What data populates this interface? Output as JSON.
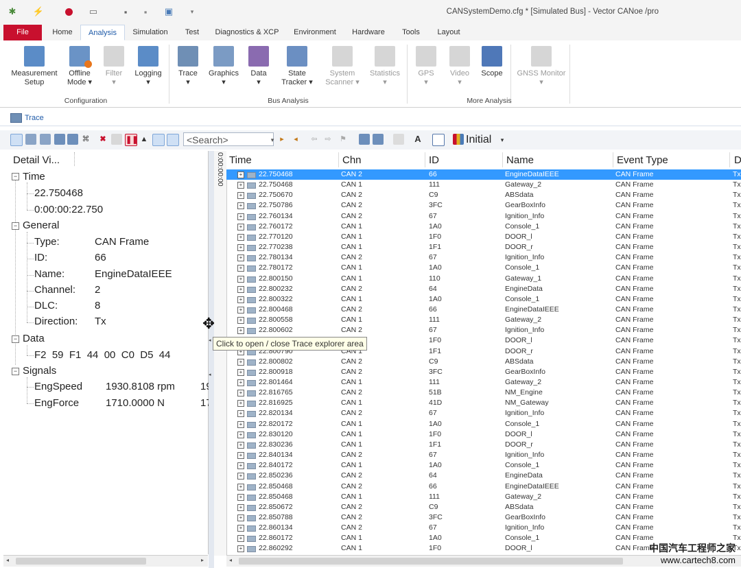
{
  "window": {
    "title": "CANSystemDemo.cfg * [Simulated Bus] - Vector CANoe /pro"
  },
  "tabs": [
    "File",
    "Home",
    "Analysis",
    "Simulation",
    "Test",
    "Diagnostics & XCP",
    "Environment",
    "Hardware",
    "Tools",
    "Layout"
  ],
  "active_tab": "Analysis",
  "ribbon": {
    "configuration": {
      "group": "Configuration",
      "buttons": [
        {
          "l1": "Measurement",
          "l2": "Setup",
          "icon": "measurement-setup-icon"
        },
        {
          "l1": "Offline",
          "l2": "Mode ▾",
          "icon": "offline-mode-icon"
        },
        {
          "l1": "Filter",
          "l2": "▾",
          "icon": "filter-icon"
        },
        {
          "l1": "Logging",
          "l2": "▾",
          "icon": "logging-icon"
        }
      ]
    },
    "bus_analysis": {
      "group": "Bus Analysis",
      "buttons": [
        {
          "l1": "Trace",
          "l2": "▾",
          "icon": "trace-icon"
        },
        {
          "l1": "Graphics",
          "l2": "▾",
          "icon": "graphics-icon"
        },
        {
          "l1": "Data",
          "l2": "▾",
          "icon": "data-icon"
        },
        {
          "l1": "State",
          "l2": "Tracker ▾",
          "icon": "state-tracker-icon"
        },
        {
          "l1": "System",
          "l2": "Scanner ▾",
          "icon": "system-scanner-icon"
        },
        {
          "l1": "Statistics",
          "l2": "▾",
          "icon": "statistics-icon"
        }
      ]
    },
    "more_analysis": {
      "group": "More Analysis",
      "buttons": [
        {
          "l1": "GPS",
          "l2": "▾",
          "icon": "gps-icon"
        },
        {
          "l1": "Video",
          "l2": "▾",
          "icon": "video-icon"
        },
        {
          "l1": "Scope",
          "l2": "",
          "icon": "scope-icon"
        },
        {
          "l1": "GNSS Monitor",
          "l2": "▾",
          "icon": "gnss-monitor-icon"
        }
      ]
    }
  },
  "trace_window": {
    "title": "Trace",
    "search_placeholder": "<Search>",
    "layout_label": "Initial",
    "time_axis_label": "0:00:00:00"
  },
  "detail_view": {
    "header": "Detail Vi...",
    "time": {
      "label": "Time",
      "seconds": "22.750468",
      "formatted": "0:00:00:22.750"
    },
    "general": {
      "label": "General",
      "fields": [
        {
          "k": "Type:",
          "v": "CAN Frame"
        },
        {
          "k": "ID:",
          "v": "66"
        },
        {
          "k": "Name:",
          "v": "EngineDataIEEE"
        },
        {
          "k": "Channel:",
          "v": "2"
        },
        {
          "k": "DLC:",
          "v": "8"
        },
        {
          "k": "Direction:",
          "v": "Tx"
        }
      ]
    },
    "data": {
      "label": "Data",
      "bytes": "F2  59  F1  44  00  C0  D5  44"
    },
    "signals": {
      "label": "Signals",
      "items": [
        {
          "name": "EngSpeed",
          "value": "1930.8108 rpm",
          "extra": "19"
        },
        {
          "name": "EngForce",
          "value": "1710.0000 N",
          "extra": "17"
        }
      ]
    }
  },
  "tooltip": "Click to open / close Trace explorer area",
  "table": {
    "columns": [
      "Time",
      "Chn",
      "ID",
      "Name",
      "Event Type",
      "D"
    ],
    "rows": [
      [
        "22.750468",
        "CAN 2",
        "66",
        "EngineDataIEEE",
        "CAN Frame",
        "Tx"
      ],
      [
        "22.750468",
        "CAN 1",
        "111",
        "Gateway_2",
        "CAN Frame",
        "Tx"
      ],
      [
        "22.750670",
        "CAN 2",
        "C9",
        "ABSdata",
        "CAN Frame",
        "Tx"
      ],
      [
        "22.750786",
        "CAN 2",
        "3FC",
        "GearBoxInfo",
        "CAN Frame",
        "Tx"
      ],
      [
        "22.760134",
        "CAN 2",
        "67",
        "Ignition_Info",
        "CAN Frame",
        "Tx"
      ],
      [
        "22.760172",
        "CAN 1",
        "1A0",
        "Console_1",
        "CAN Frame",
        "Tx"
      ],
      [
        "22.770120",
        "CAN 1",
        "1F0",
        "DOOR_l",
        "CAN Frame",
        "Tx"
      ],
      [
        "22.770238",
        "CAN 1",
        "1F1",
        "DOOR_r",
        "CAN Frame",
        "Tx"
      ],
      [
        "22.780134",
        "CAN 2",
        "67",
        "Ignition_Info",
        "CAN Frame",
        "Tx"
      ],
      [
        "22.780172",
        "CAN 1",
        "1A0",
        "Console_1",
        "CAN Frame",
        "Tx"
      ],
      [
        "22.800150",
        "CAN 1",
        "110",
        "Gateway_1",
        "CAN Frame",
        "Tx"
      ],
      [
        "22.800232",
        "CAN 2",
        "64",
        "EngineData",
        "CAN Frame",
        "Tx"
      ],
      [
        "22.800322",
        "CAN 1",
        "1A0",
        "Console_1",
        "CAN Frame",
        "Tx"
      ],
      [
        "22.800468",
        "CAN 2",
        "66",
        "EngineDataIEEE",
        "CAN Frame",
        "Tx"
      ],
      [
        "22.800558",
        "CAN 1",
        "111",
        "Gateway_2",
        "CAN Frame",
        "Tx"
      ],
      [
        "22.800602",
        "CAN 2",
        "67",
        "Ignition_Info",
        "CAN Frame",
        "Tx"
      ],
      [
        "",
        "CAN 1",
        "1F0",
        "DOOR_l",
        "CAN Frame",
        "Tx"
      ],
      [
        "22.800790",
        "CAN 1",
        "1F1",
        "DOOR_r",
        "CAN Frame",
        "Tx"
      ],
      [
        "22.800802",
        "CAN 2",
        "C9",
        "ABSdata",
        "CAN Frame",
        "Tx"
      ],
      [
        "22.800918",
        "CAN 2",
        "3FC",
        "GearBoxInfo",
        "CAN Frame",
        "Tx"
      ],
      [
        "22.801464",
        "CAN 1",
        "111",
        "Gateway_2",
        "CAN Frame",
        "Tx"
      ],
      [
        "22.816765",
        "CAN 2",
        "51B",
        "NM_Engine",
        "CAN Frame",
        "Tx"
      ],
      [
        "22.816925",
        "CAN 1",
        "41D",
        "NM_Gateway",
        "CAN Frame",
        "Tx"
      ],
      [
        "22.820134",
        "CAN 2",
        "67",
        "Ignition_Info",
        "CAN Frame",
        "Tx"
      ],
      [
        "22.820172",
        "CAN 1",
        "1A0",
        "Console_1",
        "CAN Frame",
        "Tx"
      ],
      [
        "22.830120",
        "CAN 1",
        "1F0",
        "DOOR_l",
        "CAN Frame",
        "Tx"
      ],
      [
        "22.830236",
        "CAN 1",
        "1F1",
        "DOOR_r",
        "CAN Frame",
        "Tx"
      ],
      [
        "22.840134",
        "CAN 2",
        "67",
        "Ignition_Info",
        "CAN Frame",
        "Tx"
      ],
      [
        "22.840172",
        "CAN 1",
        "1A0",
        "Console_1",
        "CAN Frame",
        "Tx"
      ],
      [
        "22.850236",
        "CAN 2",
        "64",
        "EngineData",
        "CAN Frame",
        "Tx"
      ],
      [
        "22.850468",
        "CAN 2",
        "66",
        "EngineDataIEEE",
        "CAN Frame",
        "Tx"
      ],
      [
        "22.850468",
        "CAN 1",
        "111",
        "Gateway_2",
        "CAN Frame",
        "Tx"
      ],
      [
        "22.850672",
        "CAN 2",
        "C9",
        "ABSdata",
        "CAN Frame",
        "Tx"
      ],
      [
        "22.850788",
        "CAN 2",
        "3FC",
        "GearBoxInfo",
        "CAN Frame",
        "Tx"
      ],
      [
        "22.860134",
        "CAN 2",
        "67",
        "Ignition_Info",
        "CAN Frame",
        "Tx"
      ],
      [
        "22.860172",
        "CAN 1",
        "1A0",
        "Console_1",
        "CAN Frame",
        "Tx"
      ],
      [
        "22.860292",
        "CAN 1",
        "1F0",
        "DOOR_l",
        "CAN Frame",
        "Tx"
      ]
    ],
    "selected_row": 0
  },
  "watermark": {
    "line1": "中国汽车工程师之家",
    "line2": "www.cartech8.com"
  },
  "colors": {
    "file_tab": "#c8102e",
    "accent": "#1e5aa8",
    "selection": "#3399ff"
  }
}
